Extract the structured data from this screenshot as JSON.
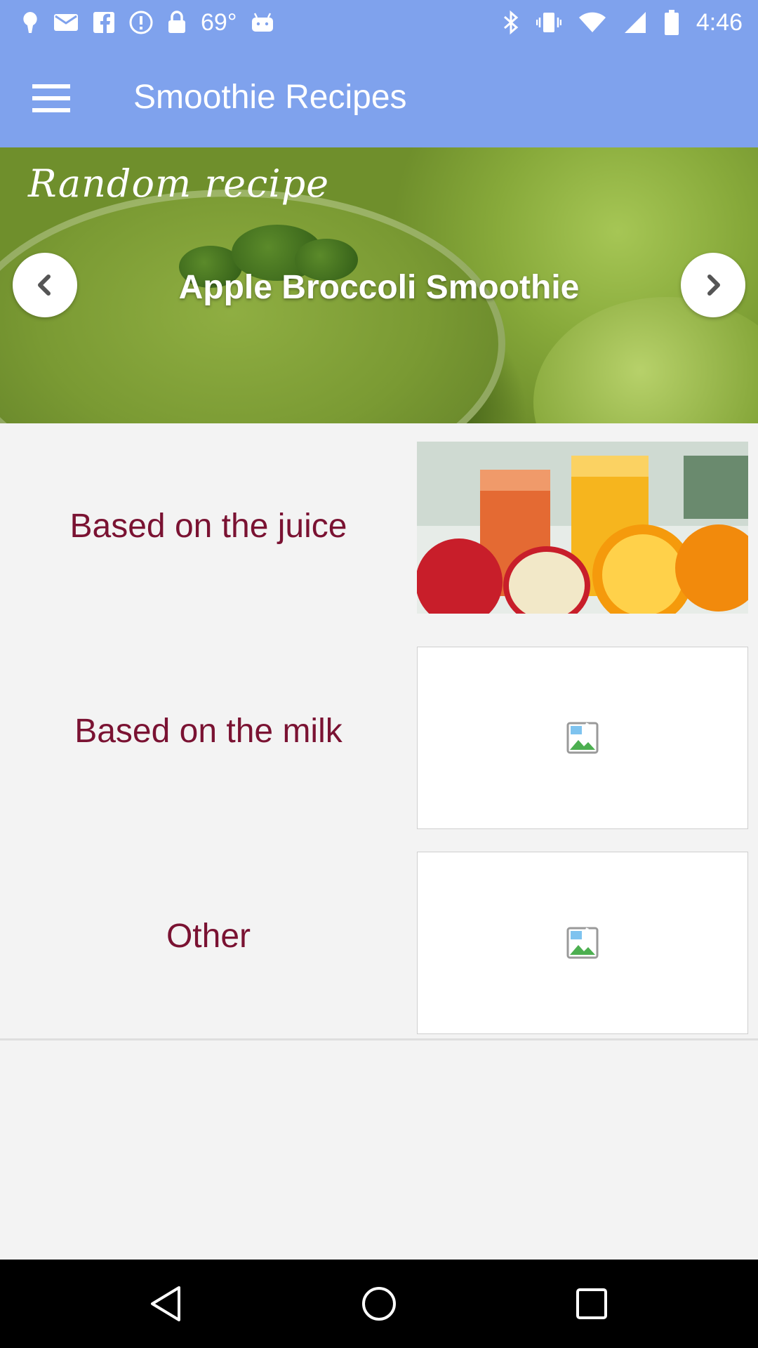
{
  "status_bar": {
    "temperature": "69°",
    "time": "4:46",
    "left_icons": [
      "location-pin-icon",
      "mail-icon",
      "facebook-icon",
      "alert-icon",
      "lock-icon",
      "android-icon"
    ],
    "right_icons": [
      "bluetooth-icon",
      "vibrate-icon",
      "wifi-icon",
      "signal-icon",
      "battery-icon"
    ]
  },
  "app_bar": {
    "menu_icon": "hamburger-menu-icon",
    "title": "Smoothie Recipes"
  },
  "hero": {
    "caption": "Random recipe",
    "recipe_title": "Apple Broccoli Smoothie",
    "prev_icon": "chevron-left-icon",
    "next_icon": "chevron-right-icon"
  },
  "categories": [
    {
      "label": "Based on the juice",
      "image": "juice-photo"
    },
    {
      "label": "Based on the milk",
      "image": "broken-image-icon"
    },
    {
      "label": "Other",
      "image": "broken-image-icon"
    }
  ],
  "nav_bar": {
    "back_icon": "back-triangle-icon",
    "home_icon": "home-circle-icon",
    "recents_icon": "recents-square-icon"
  },
  "colors": {
    "app_bar": "#7fa2ed",
    "category_text": "#7a1232",
    "background": "#f3f3f3"
  }
}
